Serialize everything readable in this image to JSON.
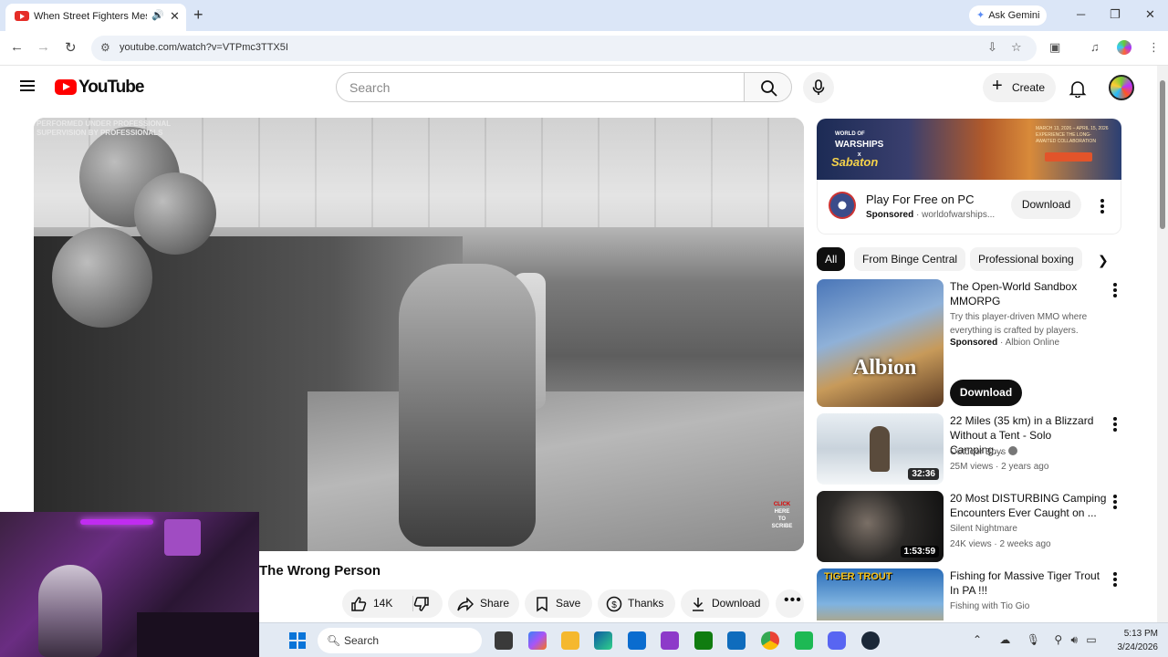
{
  "browser": {
    "tab_title": "When Street Fighters Mess",
    "url": "youtube.com/watch?v=VTPmc3TTX5I",
    "ask_gemini": "Ask Gemini",
    "new_tab_icon": "plus-icon"
  },
  "youtube": {
    "logo_text": "YouTube",
    "search_placeholder": "Search",
    "create_label": "Create"
  },
  "video": {
    "overlay_caption_line1": "PERFORMED UNDER PROFESSIONAL",
    "overlay_caption_line2": "SUPERVISION BY PROFESSIONALS",
    "subscribe_badge": [
      "CLICK",
      "HERE",
      "TO",
      "SCRIBE"
    ],
    "title": "The Wrong Person",
    "like_count": "14K",
    "share_label": "Share",
    "save_label": "Save",
    "thanks_label": "Thanks",
    "download_label": "Download"
  },
  "ad": {
    "banner_game": "WORLD OF",
    "banner_game2": "WARSHIPS",
    "banner_x": "x",
    "banner_band": "Sabaton",
    "banner_fine": "MARCH 13, 2026 – APRIL 15, 2026 EXPERIENCE THE LONG-AWAITED COLLABORATION",
    "title": "Play For Free on PC",
    "sponsored": "Sponsored",
    "domain": "· worldofwarships...",
    "download_label": "Download"
  },
  "chips": [
    "All",
    "From Binge Central",
    "Professional boxing"
  ],
  "recommendations": [
    {
      "title": "The Open-World Sandbox MMORPG",
      "description": "Try this player-driven MMO where everything is crafted by players.",
      "sponsored": "Sponsored",
      "channel": "· Albion Online",
      "thumb_text": "Albion",
      "download_label": "Download"
    },
    {
      "title": "22 Miles (35 km) in a Blizzard Without a Tent - Solo Camping...",
      "channel": "Outdoor Boys",
      "meta": "25M views · 2 years ago",
      "duration": "32:36"
    },
    {
      "title": "20 Most DISTURBING Camping Encounters Ever Caught on ...",
      "channel": "Silent Nightmare",
      "meta": "24K views · 2 weeks ago",
      "duration": "1:53:59"
    },
    {
      "title": "Fishing for Massive Tiger Trout In PA !!!",
      "channel": "Fishing with Tio Gio",
      "thumb_text": "TIGER TROUT"
    }
  ],
  "taskbar": {
    "search_label": "Search",
    "time": "5:13 PM",
    "date": "3/24/2026",
    "apps": [
      "copilot-icon",
      "file-explorer-icon",
      "edge-icon",
      "store-icon",
      "app-icon",
      "xbox-icon",
      "outlook-icon",
      "chrome-icon",
      "app-green-icon",
      "discord-icon",
      "steam-icon"
    ]
  },
  "colors": {
    "youtube_red": "#ff0000",
    "tab_strip": "#dbe6f7",
    "chip_active": "#0f0f0f"
  }
}
